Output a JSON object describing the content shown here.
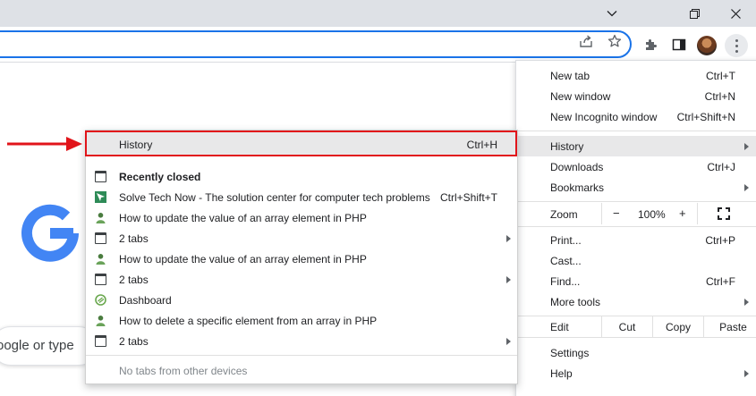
{
  "window": {
    "controls": [
      "chevron-down-icon",
      "restore-icon",
      "close-icon"
    ]
  },
  "toolbar": {
    "icons": [
      "share-icon",
      "star-icon",
      "extensions-icon",
      "side-panel-icon",
      "avatar",
      "more-icon"
    ]
  },
  "page": {
    "logo_letter": "G",
    "search_text": "oogle or type"
  },
  "main_menu": {
    "items": [
      {
        "label": "New tab",
        "shortcut": "Ctrl+T"
      },
      {
        "label": "New window",
        "shortcut": "Ctrl+N"
      },
      {
        "label": "New Incognito window",
        "shortcut": "Ctrl+Shift+N"
      },
      {
        "label": "History"
      },
      {
        "label": "Downloads",
        "shortcut": "Ctrl+J"
      },
      {
        "label": "Bookmarks"
      },
      {
        "label": "Print...",
        "shortcut": "Ctrl+P"
      },
      {
        "label": "Cast..."
      },
      {
        "label": "Find...",
        "shortcut": "Ctrl+F"
      },
      {
        "label": "More tools"
      },
      {
        "label": "Settings"
      },
      {
        "label": "Help"
      }
    ],
    "zoom": {
      "label": "Zoom",
      "minus": "−",
      "value": "100%",
      "plus": "+"
    },
    "edit": {
      "label": "Edit",
      "cut": "Cut",
      "copy": "Copy",
      "paste": "Paste"
    }
  },
  "history_menu": {
    "items": [
      {
        "label": "History",
        "shortcut": "Ctrl+H"
      },
      {
        "label": "Recently closed",
        "icon": "tab-icon"
      },
      {
        "label": "Solve Tech Now - The solution center for computer tech problems",
        "shortcut": "Ctrl+Shift+T",
        "icon": "site-favicon"
      },
      {
        "label": "How to update the value of an array element in PHP",
        "icon": "person-favicon"
      },
      {
        "label": "2 tabs",
        "icon": "tab-icon"
      },
      {
        "label": "How to update the value of an array element in PHP",
        "icon": "person-favicon"
      },
      {
        "label": "2 tabs",
        "icon": "tab-icon"
      },
      {
        "label": "Dashboard",
        "icon": "dashboard-favicon"
      },
      {
        "label": "How to delete a specific element from an array in PHP",
        "icon": "person-favicon"
      },
      {
        "label": "2 tabs",
        "icon": "tab-icon"
      },
      {
        "label": "No tabs from other devices"
      }
    ]
  },
  "annotation": {
    "color": "#e1141a"
  },
  "colors": {
    "titlebar": "#dee1e6",
    "omnibox_focus": "#1a73e8",
    "highlight": "#e8e8e9"
  }
}
